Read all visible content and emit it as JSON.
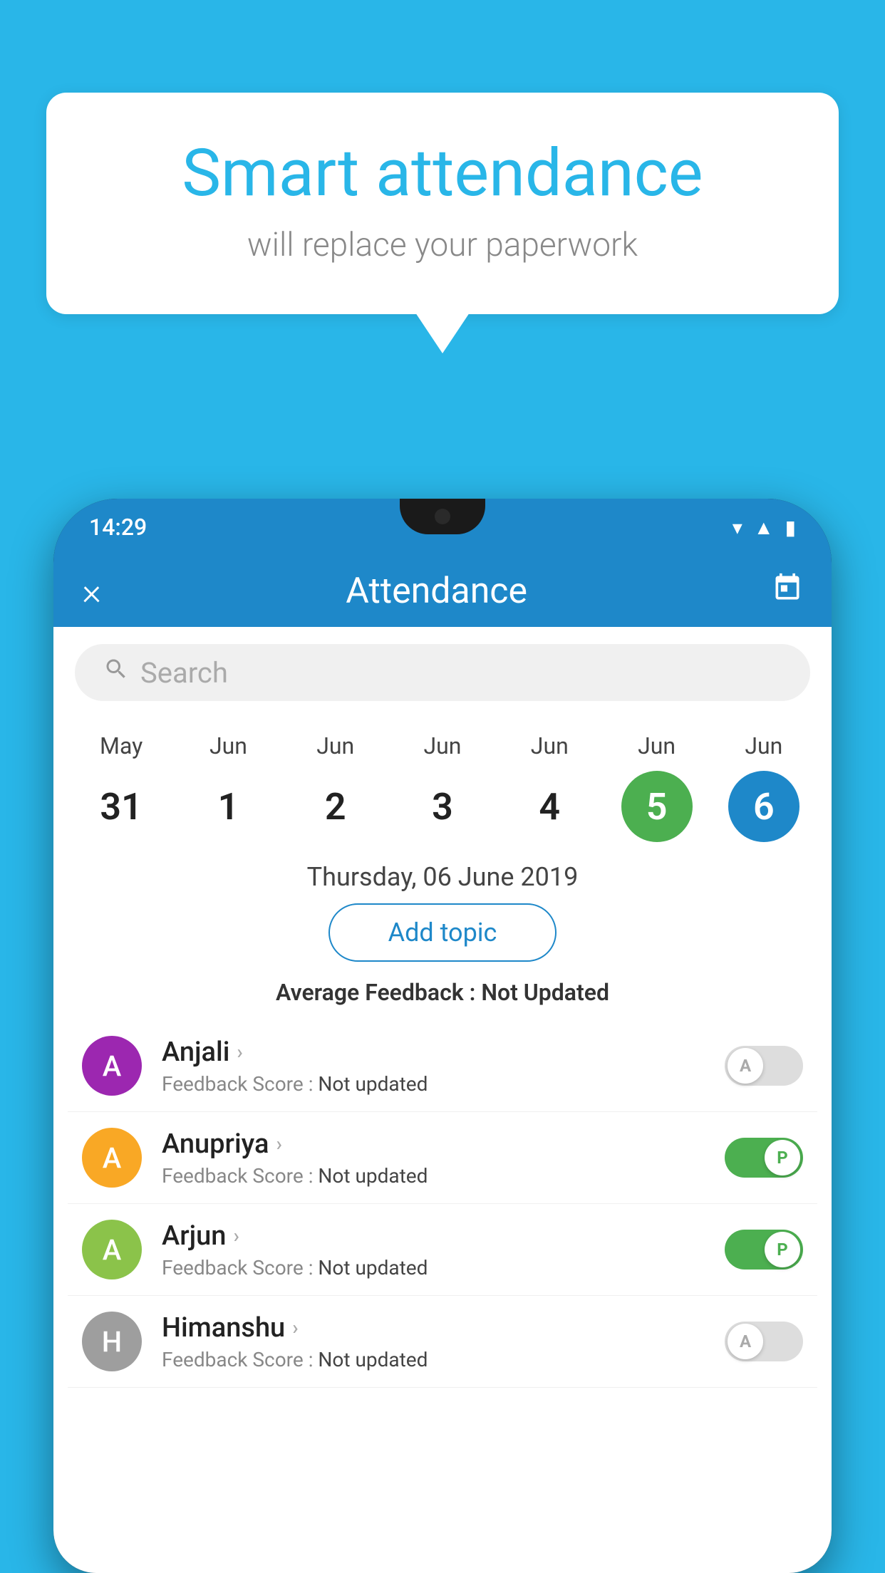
{
  "background": {
    "color": "#29b6e8"
  },
  "speech_bubble": {
    "title": "Smart attendance",
    "subtitle": "will replace your paperwork"
  },
  "phone": {
    "status_bar": {
      "time": "14:29",
      "icons": [
        "wifi",
        "signal",
        "battery"
      ]
    },
    "header": {
      "close_label": "×",
      "title": "Attendance",
      "calendar_icon": "📅"
    },
    "search": {
      "placeholder": "Search"
    },
    "calendar": {
      "dates": [
        {
          "month": "May",
          "day": "31",
          "state": "normal"
        },
        {
          "month": "Jun",
          "day": "1",
          "state": "normal"
        },
        {
          "month": "Jun",
          "day": "2",
          "state": "normal"
        },
        {
          "month": "Jun",
          "day": "3",
          "state": "normal"
        },
        {
          "month": "Jun",
          "day": "4",
          "state": "normal"
        },
        {
          "month": "Jun",
          "day": "5",
          "state": "today"
        },
        {
          "month": "Jun",
          "day": "6",
          "state": "selected"
        }
      ]
    },
    "selected_date_label": "Thursday, 06 June 2019",
    "add_topic_label": "Add topic",
    "avg_feedback_prefix": "Average Feedback : ",
    "avg_feedback_value": "Not Updated",
    "students": [
      {
        "name": "Anjali",
        "avatar_letter": "A",
        "avatar_color": "#9c27b0",
        "feedback_prefix": "Feedback Score : ",
        "feedback_value": "Not updated",
        "toggle_state": "off",
        "toggle_label": "A"
      },
      {
        "name": "Anupriya",
        "avatar_letter": "A",
        "avatar_color": "#f9a825",
        "feedback_prefix": "Feedback Score : ",
        "feedback_value": "Not updated",
        "toggle_state": "on",
        "toggle_label": "P"
      },
      {
        "name": "Arjun",
        "avatar_letter": "A",
        "avatar_color": "#8bc34a",
        "feedback_prefix": "Feedback Score : ",
        "feedback_value": "Not updated",
        "toggle_state": "on",
        "toggle_label": "P"
      },
      {
        "name": "Himanshu",
        "avatar_letter": "H",
        "avatar_color": "#9e9e9e",
        "feedback_prefix": "Feedback Score : ",
        "feedback_value": "Not updated",
        "toggle_state": "off",
        "toggle_label": "A"
      }
    ]
  }
}
